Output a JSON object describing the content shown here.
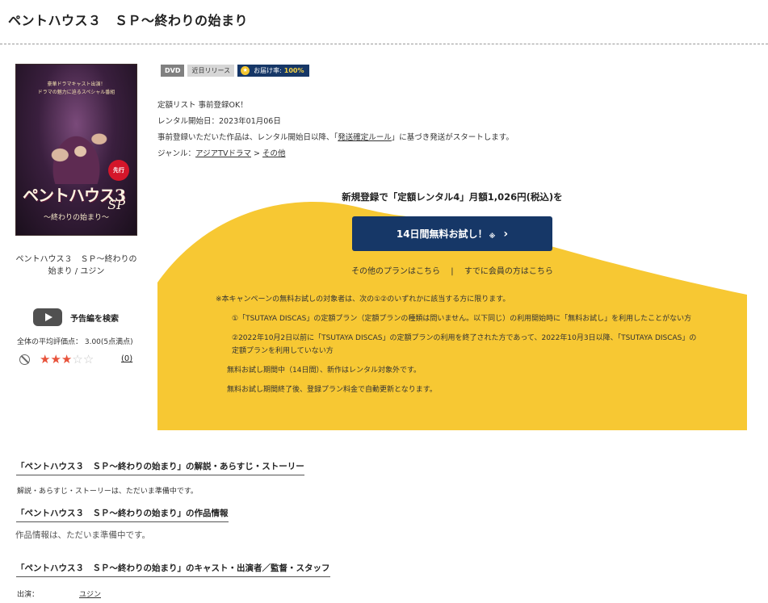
{
  "page_title": "ペントハウス３　ＳＰ〜終わりの始まり",
  "poster": {
    "top_text_1": "豪華ドラマキャスト出演！",
    "top_text_2": "ドラマの魅力に迫るスペシャル番組",
    "badge": "先行",
    "logo": "PENTHOUSE3",
    "logo_jp": "ペントハウス3",
    "sp": "SP",
    "subtitle": "〜終わりの始まり〜"
  },
  "work_name": "ペントハウス３　ＳＰ〜終わりの始まり / ユジン",
  "trailer_label": "予告編を検索",
  "rating": {
    "average_label": "全体の平均評価点：  3.00(5点満点)",
    "stars_full": 3,
    "stars_total": 5,
    "count": "(0)"
  },
  "badges": {
    "dvd": "DVD",
    "soon": "近日リリース",
    "rate_label": "お届け率:",
    "rate_value": "100%"
  },
  "info": {
    "line1": "定額リスト 事前登録OK！",
    "line2": "レンタル開始日：2023年01月06日",
    "line3_pre": "事前登録いただいた作品は、レンタル開始日以降、「",
    "line3_link": "発送確定ルール",
    "line3_post": "」に基づき発送がスタートします。",
    "genre_label": "ジャンル：",
    "genre_link1": "アジアTVドラマ",
    "genre_sep": " > ",
    "genre_link2": "その他"
  },
  "campaign": {
    "promo_text": "新規登録で「定額レンタル4」月額1,026円(税込)を",
    "button_label": "14日間無料お試し！",
    "button_mark": "※",
    "button_chevron": "›",
    "other_plans": "その他のプランはこちら",
    "separator": "|",
    "member_link": "すでに会員の方はこちら",
    "terms_intro": "※本キャンペーンの無料お試しの対象者は、次の①②のいずれかに該当する方に限ります。",
    "cond1": "①「TSUTAYA DISCAS」の定額プラン（定額プランの種類は問いません。以下同じ）の利用開始時に「無料お試し」を利用したことがない方",
    "cond2": "②2022年10月2日以前に「TSUTAYA DISCAS」の定額プランの利用を終了された方であって、2022年10月3日以降、「TSUTAYA DISCAS」の定額プランを利用していない方",
    "note1": "無料お試し期間中（14日間）、新作はレンタル対象外です。",
    "note2": "無料お試し期間終了後、登録プラン料金で自動更新となります。"
  },
  "sections": {
    "story_title": "「ペントハウス３　ＳＰ〜終わりの始まり」の解説・あらすじ・ストーリー",
    "story_text": "解説・あらすじ・ストーリーは、ただいま準備中です。",
    "info_title": "「ペントハウス３　ＳＰ〜終わりの始まり」の作品情報",
    "info_text": "作品情報は、ただいま準備中です。",
    "cast_title": "「ペントハウス３　ＳＰ〜終わりの始まり」のキャスト・出演者／監督・スタッフ",
    "cast_label": "出演：",
    "cast_name": "ユジン"
  },
  "colors": {
    "navy": "#163767",
    "yellow": "#f7c833",
    "star": "#e8523a"
  }
}
